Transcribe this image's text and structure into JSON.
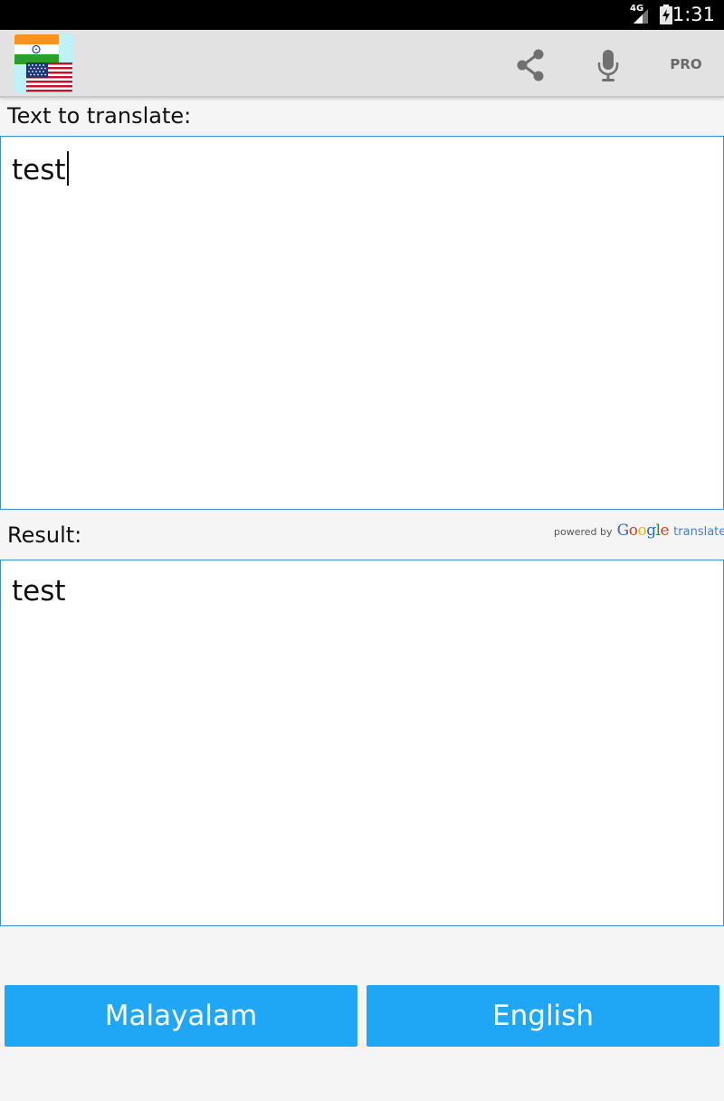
{
  "status_bar": {
    "network_label": "4G",
    "time": "1:31",
    "icons": [
      "signal-icon",
      "battery-icon"
    ]
  },
  "action_bar": {
    "logo_icon": "india-usa-flags-icon",
    "share_icon": "share-icon",
    "mic_icon": "microphone-icon",
    "pro_label": "PRO"
  },
  "source": {
    "label": "Text to translate:",
    "value": "test"
  },
  "result": {
    "label": "Result:",
    "value": "test",
    "powered_by": {
      "prefix": "powered by",
      "brand_letters": [
        {
          "ch": "G",
          "color": "#3366cc"
        },
        {
          "ch": "o",
          "color": "#dc3912"
        },
        {
          "ch": "o",
          "color": "#f2b01e"
        },
        {
          "ch": "g",
          "color": "#3366cc"
        },
        {
          "ch": "l",
          "color": "#109618"
        },
        {
          "ch": "e",
          "color": "#dc3912"
        }
      ],
      "suffix": "translate"
    }
  },
  "buttons": {
    "source_language": "Malayalam",
    "target_language": "English"
  },
  "colors": {
    "accent": "#1fa7f5",
    "input_border": "#3a8fd6",
    "action_bar": "#e2e2e2"
  }
}
